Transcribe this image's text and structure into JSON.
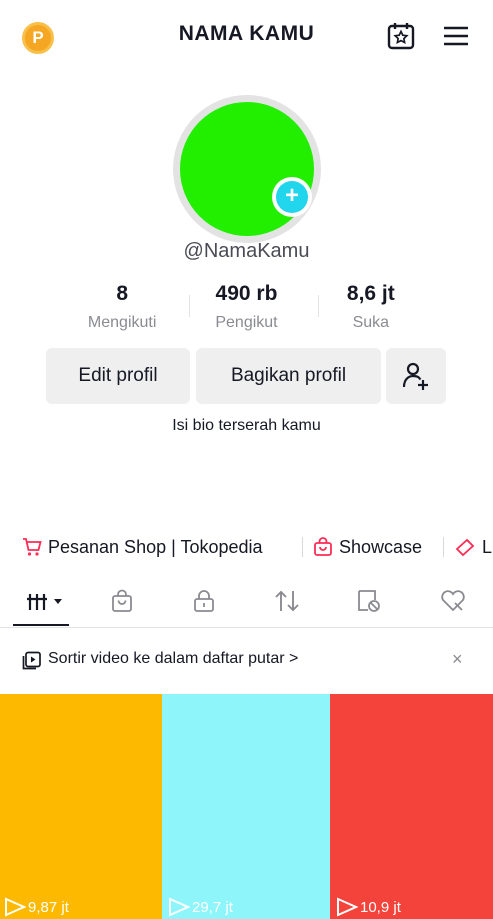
{
  "header": {
    "coin_letter": "P",
    "title": "NAMA KAMU",
    "calendar_icon": "calendar-star-icon",
    "menu_icon": "hamburger-menu-icon"
  },
  "profile": {
    "avatar_color": "#22ee00",
    "add_icon": "plus-icon",
    "username": "@NamaKamu",
    "bio": "Isi bio terserah kamu"
  },
  "stats": [
    {
      "value": "8",
      "label": "Mengikuti"
    },
    {
      "value": "490 rb",
      "label": "Pengikut"
    },
    {
      "value": "8,6 jt",
      "label": "Suka"
    }
  ],
  "actions": {
    "edit": "Edit profil",
    "share": "Bagikan profil",
    "add_friend_icon": "add-friend-icon"
  },
  "shop_links": [
    {
      "label": "Pesanan Shop | Tokopedia",
      "icon": "cart-icon"
    },
    {
      "label": "Showcase",
      "icon": "shopping-bag-icon"
    },
    {
      "label": "L",
      "icon": "ticket-icon"
    }
  ],
  "tabs": [
    {
      "icon": "videos-grid-icon",
      "active": true
    },
    {
      "icon": "shop-bag-icon"
    },
    {
      "icon": "lock-icon"
    },
    {
      "icon": "repost-icon"
    },
    {
      "icon": "tagged-icon"
    },
    {
      "icon": "liked-heart-icon"
    }
  ],
  "sort_banner": {
    "text": "Sortir video ke dalam daftar putar >",
    "close": "×"
  },
  "videos": [
    {
      "color": "#fdb900",
      "views": "9,87 jt"
    },
    {
      "color": "#8ef6fb",
      "views": "29,7 jt"
    },
    {
      "color": "#f4433a",
      "views": "10,9 jt"
    }
  ],
  "colors": {
    "accent": "#20d5ec",
    "pink": "#fe2c55",
    "text": "#161823",
    "muted": "#8a8b91"
  }
}
